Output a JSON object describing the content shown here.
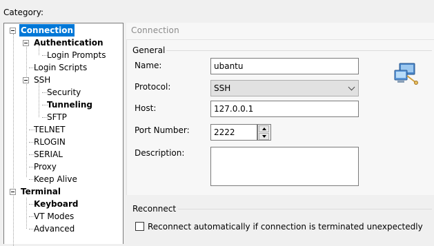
{
  "category_label": "Category:",
  "tree": {
    "items": [
      {
        "label": "Connection",
        "level": 0,
        "bold": true,
        "selected": true,
        "expanded": true
      },
      {
        "label": "Authentication",
        "level": 1,
        "bold": true,
        "expanded": true
      },
      {
        "label": "Login Prompts",
        "level": 2
      },
      {
        "label": "Login Scripts",
        "level": 1
      },
      {
        "label": "SSH",
        "level": 1,
        "expanded": true
      },
      {
        "label": "Security",
        "level": 2
      },
      {
        "label": "Tunneling",
        "level": 2,
        "bold": true
      },
      {
        "label": "SFTP",
        "level": 2
      },
      {
        "label": "TELNET",
        "level": 1
      },
      {
        "label": "RLOGIN",
        "level": 1
      },
      {
        "label": "SERIAL",
        "level": 1
      },
      {
        "label": "Proxy",
        "level": 1
      },
      {
        "label": "Keep Alive",
        "level": 1
      },
      {
        "label": "Terminal",
        "level": 0,
        "bold": true,
        "expanded": true
      },
      {
        "label": "Keyboard",
        "level": 1,
        "bold": true
      },
      {
        "label": "VT Modes",
        "level": 1
      },
      {
        "label": "Advanced",
        "level": 1
      }
    ]
  },
  "panel": {
    "title": "Connection",
    "general_label": "General",
    "name_label": "Name:",
    "name_value": "ubantu",
    "protocol_label": "Protocol:",
    "protocol_value": "SSH",
    "host_label": "Host:",
    "host_value": "127.0.0.1",
    "port_label": "Port Number:",
    "port_value": "2222",
    "description_label": "Description:",
    "description_value": "",
    "reconnect_label": "Reconnect",
    "reconnect_checkbox_label": "Reconnect automatically if connection is terminated unexpectedly",
    "reconnect_checked": false,
    "icon": "network-computers-icon"
  },
  "colors": {
    "selection": "#0078d7",
    "panel_bg": "#f7f7f7",
    "section_title": "#8a8a8a"
  }
}
